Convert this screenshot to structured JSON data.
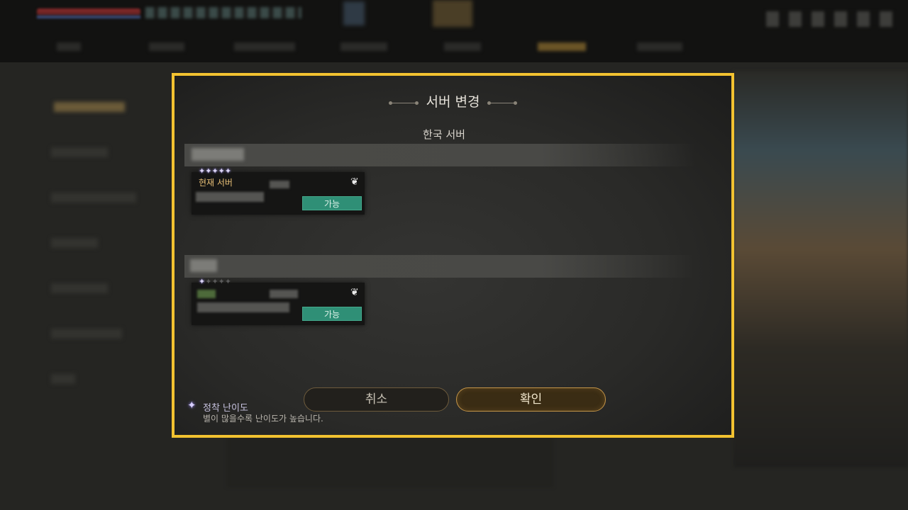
{
  "dialog": {
    "title": "서버 변경",
    "region": "한국 서버",
    "servers": [
      {
        "stars_filled": 5,
        "stars_total": 5,
        "current_label": "현재 서버",
        "status": "가능",
        "emblem_icon": "dragon-icon"
      },
      {
        "stars_filled": 1,
        "stars_total": 5,
        "status": "가능",
        "emblem_icon": "dragon-icon"
      }
    ],
    "cancel_label": "취소",
    "confirm_label": "확인",
    "legend": {
      "icon": "star-icon",
      "title": "정착 난이도",
      "description": "별이 많을수록 난이도가 높습니다."
    }
  },
  "colors": {
    "highlight_border": "#f2c230",
    "available_badge": "#2f8f76",
    "current_server_label": "#e8c077"
  }
}
